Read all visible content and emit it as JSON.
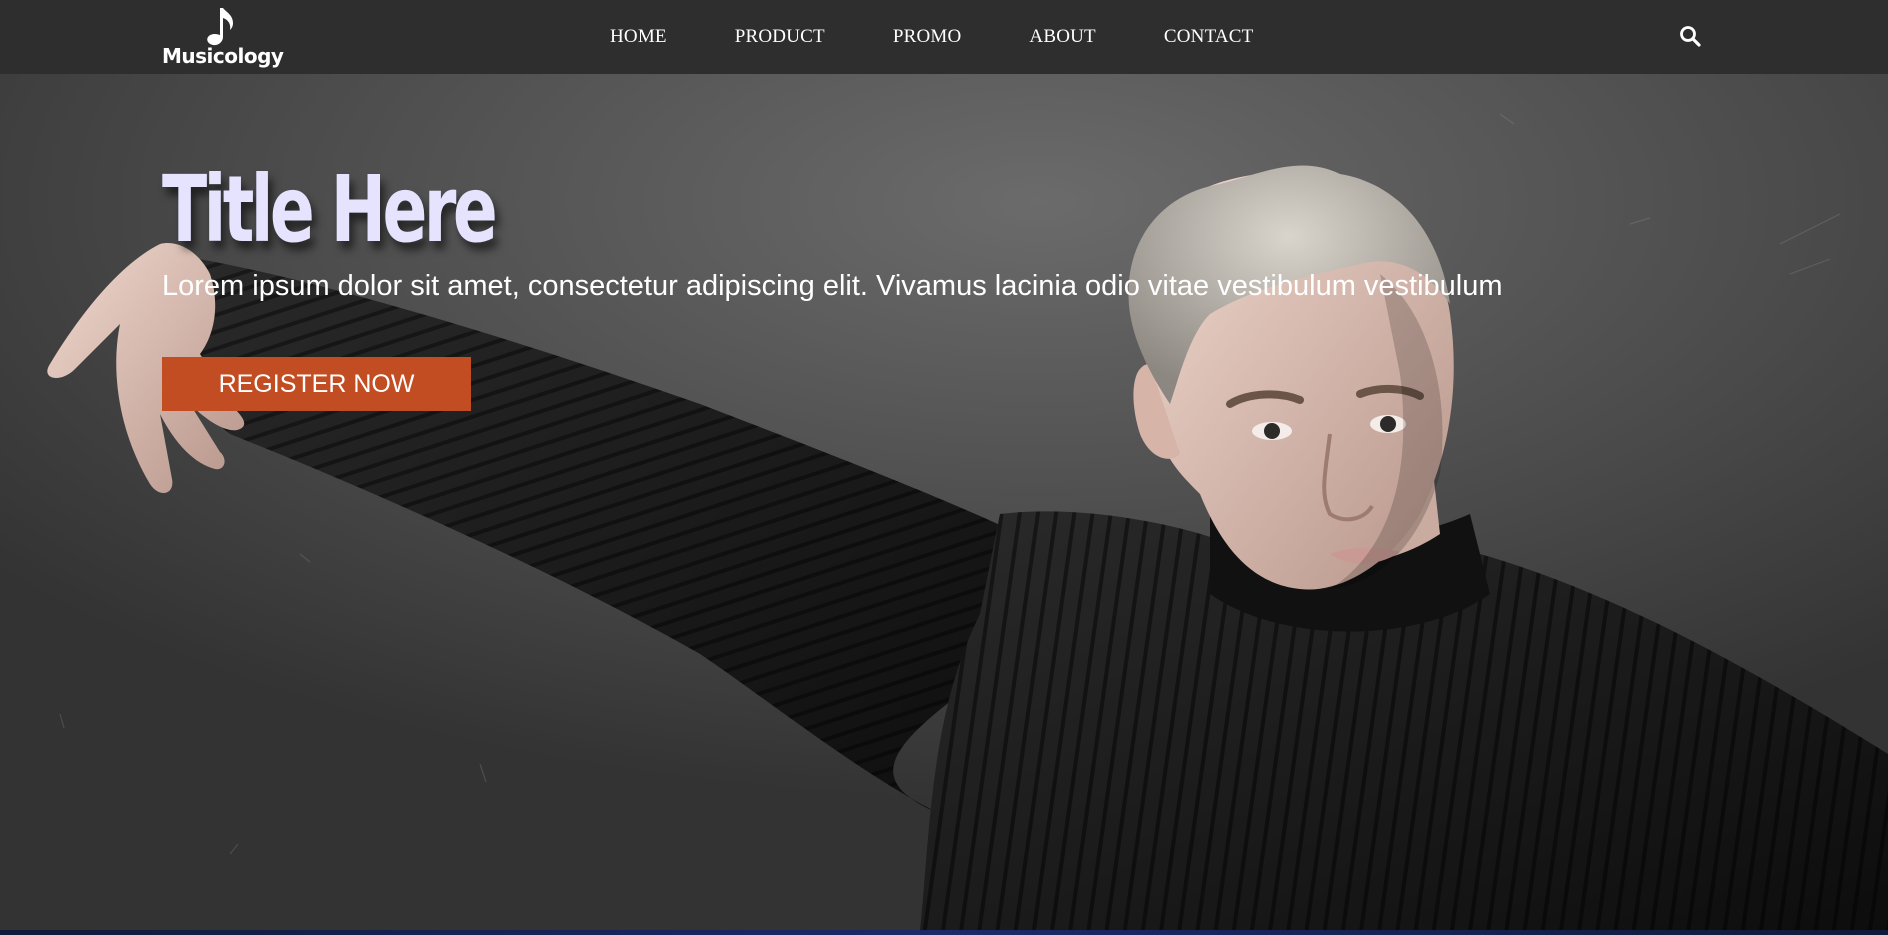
{
  "brand": {
    "name": "Musicology",
    "logo_icon": "music-note-icon"
  },
  "nav": {
    "items": [
      {
        "label": "HOME"
      },
      {
        "label": "PRODUCT"
      },
      {
        "label": "PROMO"
      },
      {
        "label": "ABOUT"
      },
      {
        "label": "CONTACT"
      }
    ],
    "search_icon": "search-icon"
  },
  "hero": {
    "title": "Title Here",
    "subtitle": "Lorem ipsum dolor sit amet, consectetur adipiscing elit. Vivamus lacinia odio vitae vestibulum vestibulum",
    "cta_label": "REGISTER NOW",
    "image_subject": "dancer-photo"
  },
  "colors": {
    "navbar": "#2e2e2e",
    "cta": "#c24d22",
    "title": "#e6e3ff",
    "text": "#ffffff"
  }
}
